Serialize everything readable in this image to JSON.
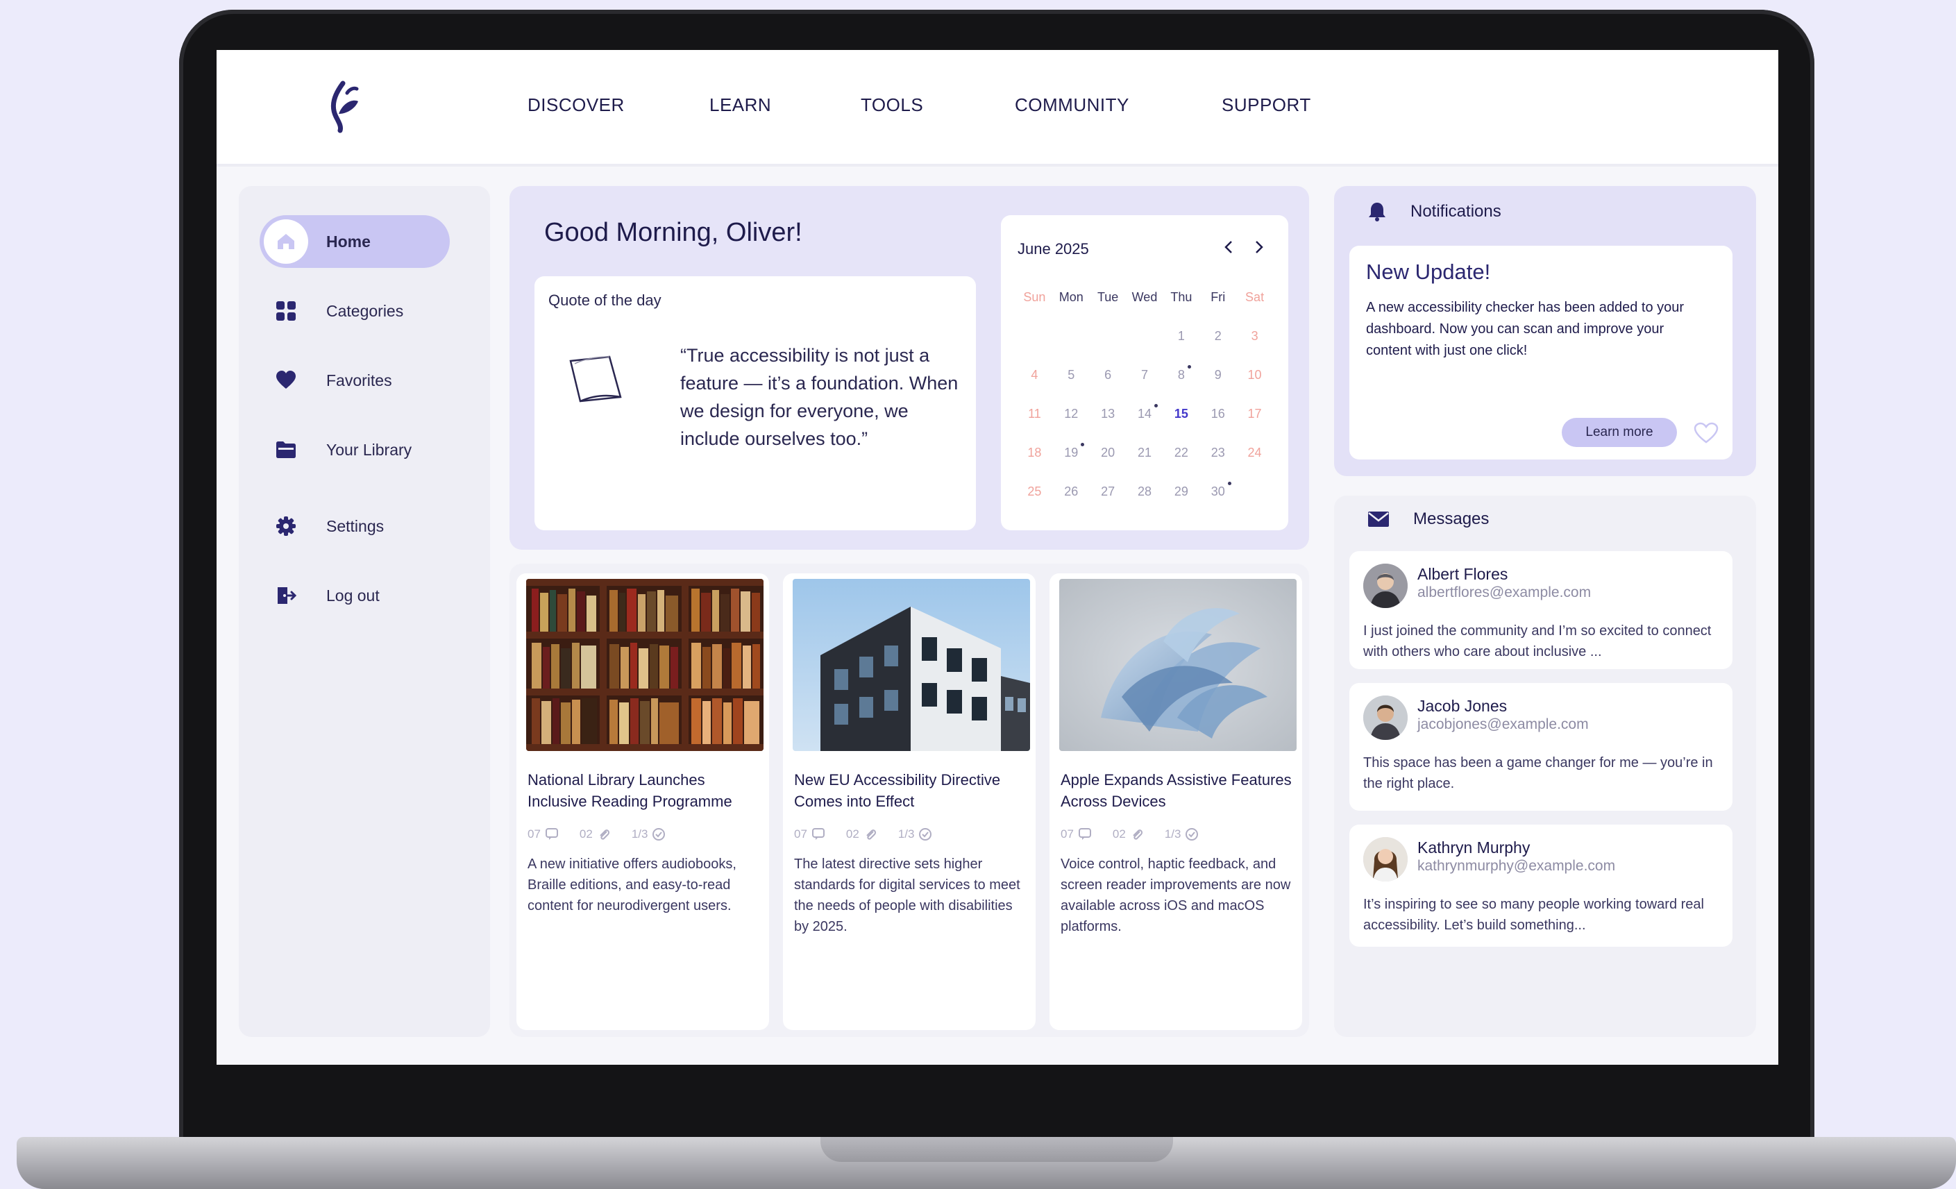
{
  "nav": {
    "items": [
      {
        "label": "DISCOVER"
      },
      {
        "label": "LEARN"
      },
      {
        "label": "TOOLS"
      },
      {
        "label": "COMMUNITY"
      },
      {
        "label": "SUPPORT"
      }
    ]
  },
  "sidebar": {
    "items": [
      {
        "label": "Home",
        "icon": "home-icon",
        "active": true
      },
      {
        "label": "Categories",
        "icon": "grid-icon"
      },
      {
        "label": "Favorites",
        "icon": "heart-icon"
      },
      {
        "label": "Your Library",
        "icon": "folder-icon"
      },
      {
        "label": "Settings",
        "icon": "gear-icon"
      },
      {
        "label": "Log out",
        "icon": "logout-icon"
      }
    ]
  },
  "greeting": {
    "title": "Good Morning, Oliver!",
    "quote_label": "Quote of the day",
    "quote_text": "“True accessibility is not just a feature — it’s a foundation. When we design for everyone, we include ourselves too.”"
  },
  "calendar": {
    "month_label": "June 2025",
    "weekdays": [
      "Sun",
      "Mon",
      "Tue",
      "Wed",
      "Thu",
      "Fri",
      "Sat"
    ],
    "leading_blanks": 4,
    "days": [
      "1",
      "2",
      "3",
      "4",
      "5",
      "6",
      "7",
      "8",
      "9",
      "10",
      "11",
      "12",
      "13",
      "14",
      "15",
      "16",
      "17",
      "18",
      "19",
      "20",
      "21",
      "22",
      "23",
      "24",
      "25",
      "26",
      "27",
      "28",
      "29",
      "30"
    ],
    "today": "15",
    "event_days": [
      "8",
      "14",
      "19",
      "30"
    ]
  },
  "articles": [
    {
      "title": "National Library Launches Inclusive Reading Programme",
      "comments": "07",
      "attachments": "02",
      "progress": "1/3",
      "desc": "A new initiative offers audiobooks, Braille editions, and easy-to-read content for neurodivergent users."
    },
    {
      "title": "New EU Accessibility Directive Comes into Effect",
      "comments": "07",
      "attachments": "02",
      "progress": "1/3",
      "desc": "The latest directive sets higher standards for digital services to meet the needs of people with disabilities by 2025."
    },
    {
      "title": "Apple Expands Assistive Features Across Devices",
      "comments": "07",
      "attachments": "02",
      "progress": "1/3",
      "desc": "Voice control, haptic feedback, and screen reader improvements are now available across iOS and macOS platforms."
    }
  ],
  "notifications": {
    "header": "Notifications",
    "title": "New Update!",
    "text": "A new accessibility checker has been added to your dashboard. Now you can scan and improve your content with just one click!",
    "button": "Learn more"
  },
  "messages": {
    "header": "Messages",
    "items": [
      {
        "name": "Albert Flores",
        "email": "albertflores@example.com",
        "text": "I just joined the community and I’m so excited to connect with others who care about inclusive ..."
      },
      {
        "name": "Jacob Jones",
        "email": "jacobjones@example.com",
        "text": "This space has been a game changer for me — you’re in the right place."
      },
      {
        "name": "Kathryn Murphy",
        "email": "kathrynmurphy@example.com",
        "text": "It’s inspiring to see so many people working toward real accessibility. Let’s build something..."
      }
    ]
  },
  "colors": {
    "page_bg": "#ecebfb",
    "accent": "#c9c6f3",
    "accent_dark": "#2b2770",
    "text": "#1e1b4b",
    "weekend": "#f0a29b"
  }
}
